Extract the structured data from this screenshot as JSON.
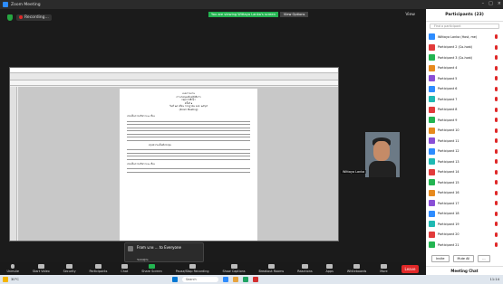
{
  "window": {
    "title": "Zoom Meeting"
  },
  "topbar": {
    "recording": "Recording..."
  },
  "share_banner": {
    "message": "You are viewing Wittaya Lanka's screen",
    "options": "View Options"
  },
  "view": "View",
  "document": {
    "heading_lines": [
      "แบบรายงาน",
      "การประชุมเชิงปฏิบัติการ",
      "กลุ่มการศึกษา",
      "ครั้งที่ ๑",
      "วันที่ ๒๔ เดือน กรกฎาคม พ.ศ. ๒๕๖๕",
      "(Zoom Meeting)"
    ],
    "section1": "ประเด็นการอภิปราย ๑ เรื่อง",
    "section2": "สรุปความเห็นที่ประชุม",
    "section3": "ประเด็นการอภิปราย ๒ เรื่อง"
  },
  "self_view": {
    "name": "Wittaya Lanka"
  },
  "chat_popup": {
    "from": "From นาย ... to Everyone",
    "body": "ขอบคุณ"
  },
  "controls": [
    {
      "label": "Unmute",
      "name": "unmute-button"
    },
    {
      "label": "Start Video",
      "name": "start-video-button"
    },
    {
      "label": "Security",
      "name": "security-button"
    },
    {
      "label": "Participants",
      "name": "participants-button"
    },
    {
      "label": "Chat",
      "name": "chat-button"
    },
    {
      "label": "Share Screen",
      "name": "share-screen-button"
    },
    {
      "label": "Pause/Stop Recording",
      "name": "recording-button"
    },
    {
      "label": "Show Captions",
      "name": "captions-button"
    },
    {
      "label": "Breakout Rooms",
      "name": "breakout-rooms-button"
    },
    {
      "label": "Reactions",
      "name": "reactions-button"
    },
    {
      "label": "Apps",
      "name": "apps-button"
    },
    {
      "label": "Whiteboards",
      "name": "whiteboards-button"
    },
    {
      "label": "More",
      "name": "more-button"
    }
  ],
  "leave": "Leave",
  "participants": {
    "title": "Participants (23)",
    "search_placeholder": "Find a participant",
    "list": [
      {
        "name": "Wittaya Lanka (Host, me)",
        "color": "#2d8cff"
      },
      {
        "name": "Participant 2 (Co-host)",
        "color": "#e23b3b"
      },
      {
        "name": "Participant 3 (Co-host)",
        "color": "#23b451"
      },
      {
        "name": "Participant 4",
        "color": "#e78a1e"
      },
      {
        "name": "Participant 5",
        "color": "#8a4fd6"
      },
      {
        "name": "Participant 6",
        "color": "#2d8cff"
      },
      {
        "name": "Participant 7",
        "color": "#1fb9b3"
      },
      {
        "name": "Participant 8",
        "color": "#e23b3b"
      },
      {
        "name": "Participant 9",
        "color": "#23b451"
      },
      {
        "name": "Participant 10",
        "color": "#e78a1e"
      },
      {
        "name": "Participant 11",
        "color": "#8a4fd6"
      },
      {
        "name": "Participant 12",
        "color": "#2d8cff"
      },
      {
        "name": "Participant 13",
        "color": "#1fb9b3"
      },
      {
        "name": "Participant 14",
        "color": "#e23b3b"
      },
      {
        "name": "Participant 15",
        "color": "#23b451"
      },
      {
        "name": "Participant 16",
        "color": "#e78a1e"
      },
      {
        "name": "Participant 17",
        "color": "#8a4fd6"
      },
      {
        "name": "Participant 18",
        "color": "#2d8cff"
      },
      {
        "name": "Participant 19",
        "color": "#1fb9b3"
      },
      {
        "name": "Participant 20",
        "color": "#e23b3b"
      },
      {
        "name": "Participant 21",
        "color": "#23b451"
      }
    ],
    "invite": "Invite",
    "mute_all": "Mute All",
    "more": "...",
    "chat_title": "Meeting Chat"
  },
  "taskbar": {
    "weather": "30°C",
    "search": "Search",
    "time": "11:14"
  }
}
